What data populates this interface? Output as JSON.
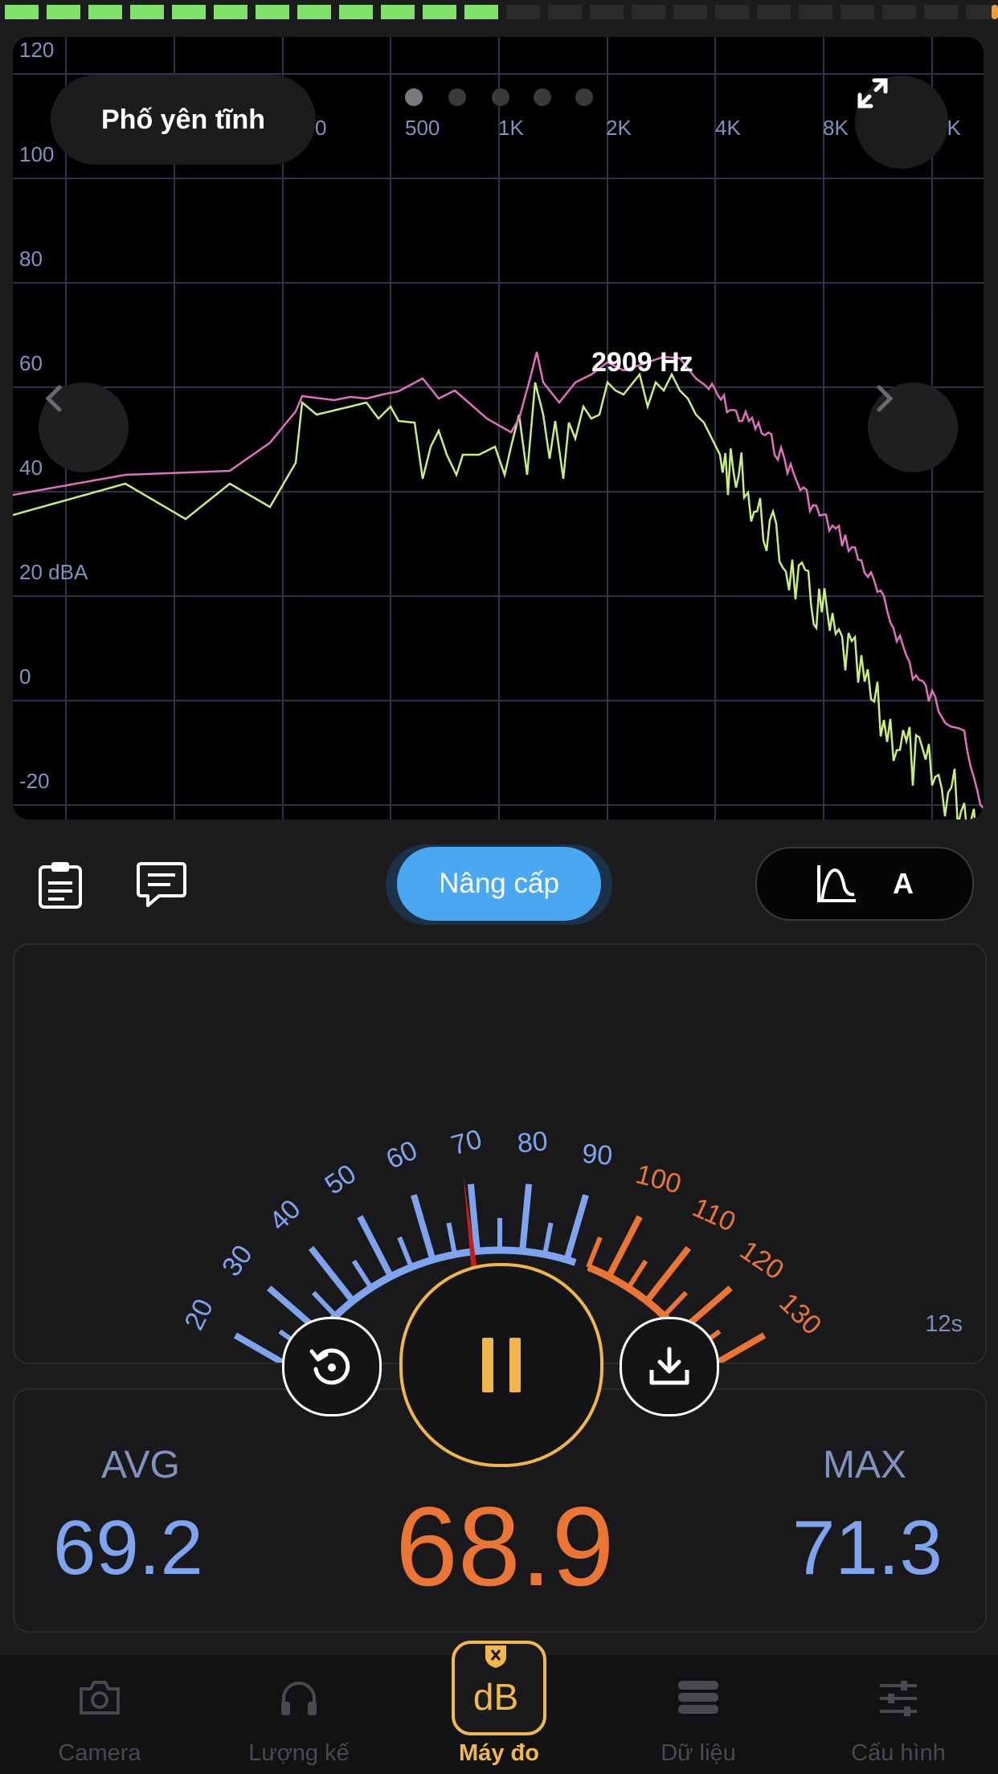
{
  "level_meter": {
    "lit_segments": 12,
    "total_segments": 24,
    "lit_color": "#7fe06a",
    "dim_color": "#2a2a2c",
    "edge_color": "#f0a030"
  },
  "spectrum": {
    "preset_label": "Phố yên tĩnh",
    "peak_label": "2909 Hz",
    "y_ticks": [
      "120",
      "100",
      "80",
      "60",
      "40",
      "20 dBA",
      "0",
      "-20"
    ],
    "x_ticks": [
      "0",
      "500",
      "1K",
      "2K",
      "4K",
      "8K",
      "6K"
    ],
    "page_dots": 5,
    "active_dot": 0,
    "curve_colors": {
      "peak": "#e06fbf",
      "current": "#c8ef7e"
    },
    "grid_color": "#2e3448",
    "tick_color": "#7f93be"
  },
  "toolbar": {
    "upgrade_label": "Nâng cấp",
    "weighting_label": "A"
  },
  "gauge": {
    "scale_labels": [
      "20",
      "30",
      "40",
      "50",
      "60",
      "70",
      "80",
      "90",
      "100",
      "110",
      "120",
      "130"
    ],
    "needle_value": 68.9,
    "elapsed": "12s",
    "blue": "#7fa4ef",
    "orange": "#eb7535",
    "needle_color": "#c11f1a"
  },
  "stats": {
    "avg_label": "AVG",
    "avg_value": "69.2",
    "current_value": "68.9",
    "max_label": "MAX",
    "max_value": "71.3"
  },
  "tabs": [
    {
      "label": "Camera",
      "icon": "camera-icon"
    },
    {
      "label": "Lượng kế",
      "icon": "headphones-icon"
    },
    {
      "label": "Máy đo",
      "icon": "db-meter-icon",
      "badge": "dB"
    },
    {
      "label": "Dữ liệu",
      "icon": "database-icon"
    },
    {
      "label": "Cấu hình",
      "icon": "sliders-icon"
    }
  ],
  "accent": "#f0b84f"
}
